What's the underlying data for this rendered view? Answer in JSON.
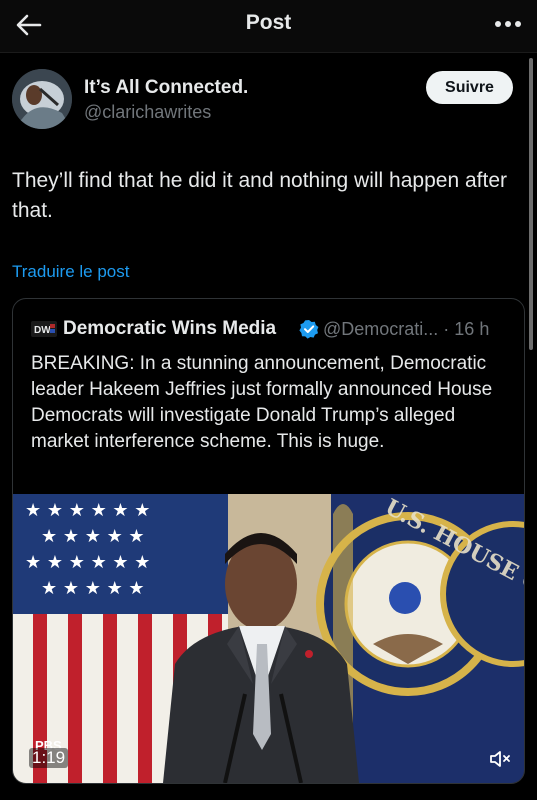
{
  "header": {
    "title": "Post",
    "back_icon": "arrow-left-icon",
    "more_icon": "more-horizontal-icon"
  },
  "author": {
    "name": "It’s All Connected.",
    "handle": "@clarichawrites",
    "follow_label": "Suivre"
  },
  "post": {
    "text": "They’ll find that he did it and nothing will happen after that.",
    "translate_label": "Traduire le post"
  },
  "quote": {
    "logo_text": "DW",
    "name": "Democratic Wins Media",
    "handle_time": "@Democrati... · 16 h",
    "text": "BREAKING: In a stunning announcement, Democratic leader Hakeem Jeffries just formally announced House Democrats will investigate Donald Trump’s alleged market interference scheme. This is huge.",
    "video": {
      "network": "PBS",
      "timestamp": "1:19",
      "seal_text": "U.S. HOUSE OF REPRESENTATIVES"
    }
  },
  "colors": {
    "accent": "#1d9bf0",
    "verified": "#1d9bf0",
    "background": "#000000"
  }
}
